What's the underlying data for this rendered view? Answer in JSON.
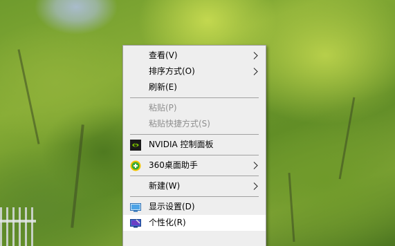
{
  "context_menu": {
    "items": [
      {
        "label": "查看(V)"
      },
      {
        "label": "排序方式(O)"
      },
      {
        "label": "刷新(E)"
      },
      {
        "label": "粘贴(P)"
      },
      {
        "label": "粘贴快捷方式(S)"
      },
      {
        "label": "NVIDIA 控制面板",
        "icon": "nvidia-icon"
      },
      {
        "label": "360桌面助手",
        "icon": "360-desktop-assistant-icon"
      },
      {
        "label": "新建(W)"
      },
      {
        "label": "显示设置(D)",
        "icon": "display-settings-icon"
      },
      {
        "label": "个性化(R)",
        "icon": "personalize-icon"
      }
    ]
  },
  "colors": {
    "menu_background": "#eeeeee",
    "menu_border": "#a0a0a0",
    "disabled_text": "#8f8f8f",
    "highlight": "#ffffff",
    "nvidia_green": "#76b900",
    "icon_360_yellow": "#f2c500",
    "icon_360_green": "#3aa935"
  }
}
